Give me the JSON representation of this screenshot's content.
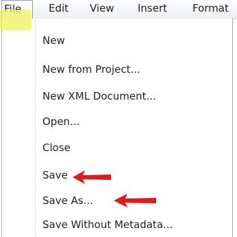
{
  "menubar": {
    "items": [
      {
        "label": "File"
      },
      {
        "label": "Edit"
      },
      {
        "label": "View"
      },
      {
        "label": "Insert"
      },
      {
        "label": "Format"
      }
    ]
  },
  "file_menu": {
    "items": [
      {
        "label": "New"
      },
      {
        "label": "New from Project..."
      },
      {
        "label": "New XML Document..."
      },
      {
        "label": "Open..."
      },
      {
        "label": "Close"
      },
      {
        "label": "Save"
      },
      {
        "label": "Save As..."
      },
      {
        "label": "Save Without Metadata..."
      }
    ]
  },
  "annotations": {
    "arrow_color": "#e01a1a",
    "highlight_color": "#f2f25a"
  }
}
